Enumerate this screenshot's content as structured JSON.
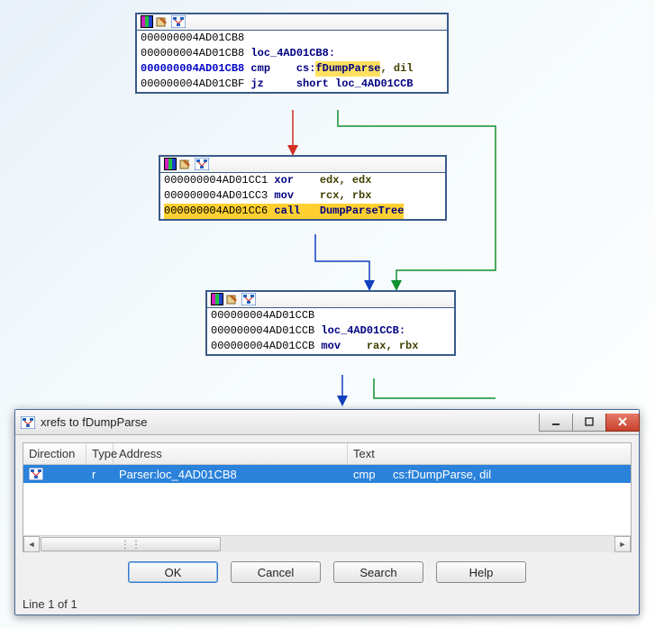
{
  "nodes": [
    {
      "lines": [
        {
          "addr": "000000004AD01CB8",
          "addr_cls": "addr",
          "rest": []
        },
        {
          "addr": "000000004AD01CB8",
          "addr_cls": "addr",
          "rest": [
            {
              "t": "loc_4AD01CB8:",
              "cls": "label"
            }
          ]
        },
        {
          "addr": "000000004AD01CB8",
          "addr_cls": "addr-blue",
          "rest": [
            {
              "t": "cmp",
              "cls": "mnemonic",
              "w": 7
            },
            {
              "t": "cs:",
              "cls": "operand"
            },
            {
              "t": "fDumpParse",
              "cls": "operand",
              "hl": "yellow"
            },
            {
              "t": ", dil",
              "cls": "op-dark"
            }
          ]
        },
        {
          "addr": "000000004AD01CBF",
          "addr_cls": "addr",
          "rest": [
            {
              "t": "jz",
              "cls": "mnemonic",
              "w": 7
            },
            {
              "t": "short loc_4AD01CCB",
              "cls": "operand"
            }
          ]
        }
      ]
    },
    {
      "lines": [
        {
          "addr": "000000004AD01CC1",
          "addr_cls": "addr",
          "rest": [
            {
              "t": "xor",
              "cls": "mnemonic",
              "w": 7
            },
            {
              "t": "edx, edx",
              "cls": "op-dark"
            }
          ]
        },
        {
          "addr": "000000004AD01CC3",
          "addr_cls": "addr",
          "rest": [
            {
              "t": "mov",
              "cls": "mnemonic",
              "w": 7
            },
            {
              "t": "rcx, rbx",
              "cls": "op-dark"
            }
          ]
        },
        {
          "addr": "000000004AD01CC6",
          "addr_cls": "addr",
          "hl": "orange",
          "rest": [
            {
              "t": "call",
              "cls": "mnemonic",
              "w": 7,
              "hl": "orange"
            },
            {
              "t": "DumpParseTree",
              "cls": "operand",
              "hl": "orange"
            }
          ]
        }
      ]
    },
    {
      "lines": [
        {
          "addr": "000000004AD01CCB",
          "addr_cls": "addr",
          "rest": []
        },
        {
          "addr": "000000004AD01CCB",
          "addr_cls": "addr",
          "rest": [
            {
              "t": "loc_4AD01CCB:",
              "cls": "label"
            }
          ]
        },
        {
          "addr": "000000004AD01CCB",
          "addr_cls": "addr",
          "rest": [
            {
              "t": "mov",
              "cls": "mnemonic",
              "w": 7
            },
            {
              "t": "rax, rbx",
              "cls": "op-dark"
            }
          ]
        }
      ]
    }
  ],
  "dialog": {
    "title": "xrefs to fDumpParse",
    "columns": {
      "dir": "Direction",
      "typ": "Type",
      "addr": "Address",
      "text": "Text"
    },
    "row": {
      "typ": "r",
      "addr": "Parser:loc_4AD01CB8",
      "mnem": "cmp",
      "op": "cs:fDumpParse, dil"
    },
    "buttons": {
      "ok": "OK",
      "cancel": "Cancel",
      "search": "Search",
      "help": "Help"
    },
    "status": "Line 1 of 1"
  }
}
